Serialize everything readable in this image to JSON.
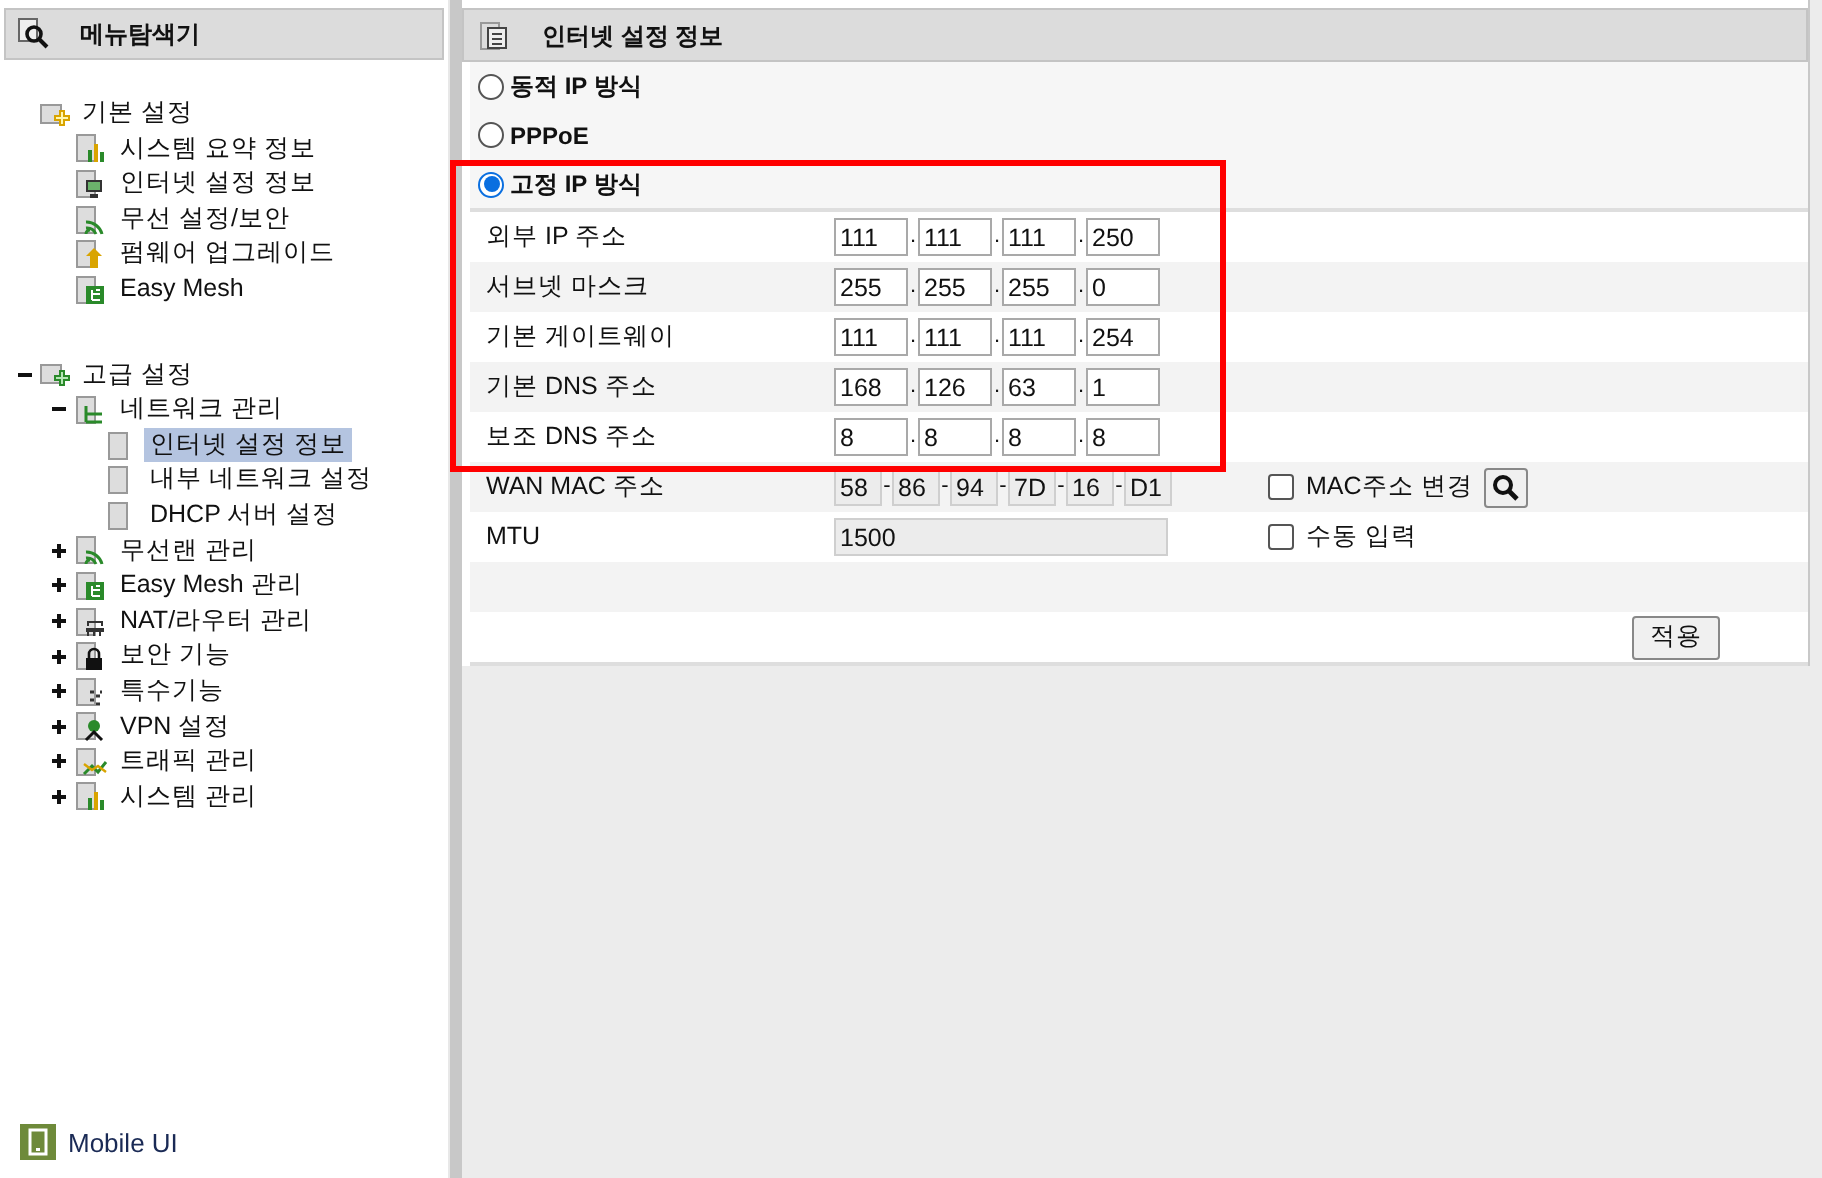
{
  "sidebar": {
    "title": "메뉴탐색기",
    "tree": [
      {
        "label": "기본 설정",
        "children": [
          {
            "label": "시스템 요약 정보",
            "selected": false
          },
          {
            "label": "인터넷 설정 정보",
            "selected": false
          },
          {
            "label": "무선 설정/보안",
            "selected": false
          },
          {
            "label": "펌웨어 업그레이드",
            "selected": false
          },
          {
            "label": "Easy Mesh",
            "selected": false
          }
        ]
      },
      {
        "label": "고급 설정",
        "expanded": true,
        "children": [
          {
            "label": "네트워크 관리",
            "expanded": true,
            "children": [
              {
                "label": "인터넷 설정 정보",
                "selected": true
              },
              {
                "label": "내부 네트워크 설정",
                "selected": false
              },
              {
                "label": "DHCP 서버 설정",
                "selected": false
              }
            ]
          },
          {
            "label": "무선랜 관리",
            "expanded": false
          },
          {
            "label": "Easy Mesh 관리",
            "expanded": false
          },
          {
            "label": "NAT/라우터 관리",
            "expanded": false
          },
          {
            "label": "보안 기능",
            "expanded": false
          },
          {
            "label": "특수기능",
            "expanded": false
          },
          {
            "label": "VPN 설정",
            "expanded": false
          },
          {
            "label": "트래픽 관리",
            "expanded": false
          },
          {
            "label": "시스템 관리",
            "expanded": false
          }
        ]
      }
    ],
    "mobile_link": "Mobile UI"
  },
  "main": {
    "title": "인터넷 설정 정보",
    "connection_types": [
      {
        "label": "동적 IP 방식",
        "selected": false
      },
      {
        "label": "PPPoE",
        "selected": false
      },
      {
        "label": "고정 IP 방식",
        "selected": true
      }
    ],
    "fields": [
      {
        "kind": "ip",
        "label": "외부 IP 주소",
        "separator": ".",
        "parts": [
          "111",
          "111",
          "111",
          "250"
        ]
      },
      {
        "kind": "ip",
        "label": "서브넷 마스크",
        "separator": ".",
        "parts": [
          "255",
          "255",
          "255",
          "0"
        ]
      },
      {
        "kind": "ip",
        "label": "기본 게이트웨이",
        "separator": ".",
        "parts": [
          "111",
          "111",
          "111",
          "254"
        ]
      },
      {
        "kind": "ip",
        "label": "기본 DNS 주소",
        "separator": ".",
        "parts": [
          "168",
          "126",
          "63",
          "1"
        ]
      },
      {
        "kind": "ip",
        "label": "보조 DNS 주소",
        "separator": ".",
        "parts": [
          "8",
          "8",
          "8",
          "8"
        ]
      },
      {
        "kind": "mac",
        "label": "WAN MAC 주소",
        "separator": "-",
        "parts": [
          "58",
          "86",
          "94",
          "7D",
          "16",
          "D1"
        ],
        "disabled": true,
        "option": {
          "label": "MAC주소 변경",
          "checked": false,
          "search_button": true
        }
      },
      {
        "kind": "text",
        "label": "MTU",
        "value": "1500",
        "disabled": true,
        "option": {
          "label": "수동 입력",
          "checked": false
        }
      }
    ],
    "apply_button": "적용"
  }
}
